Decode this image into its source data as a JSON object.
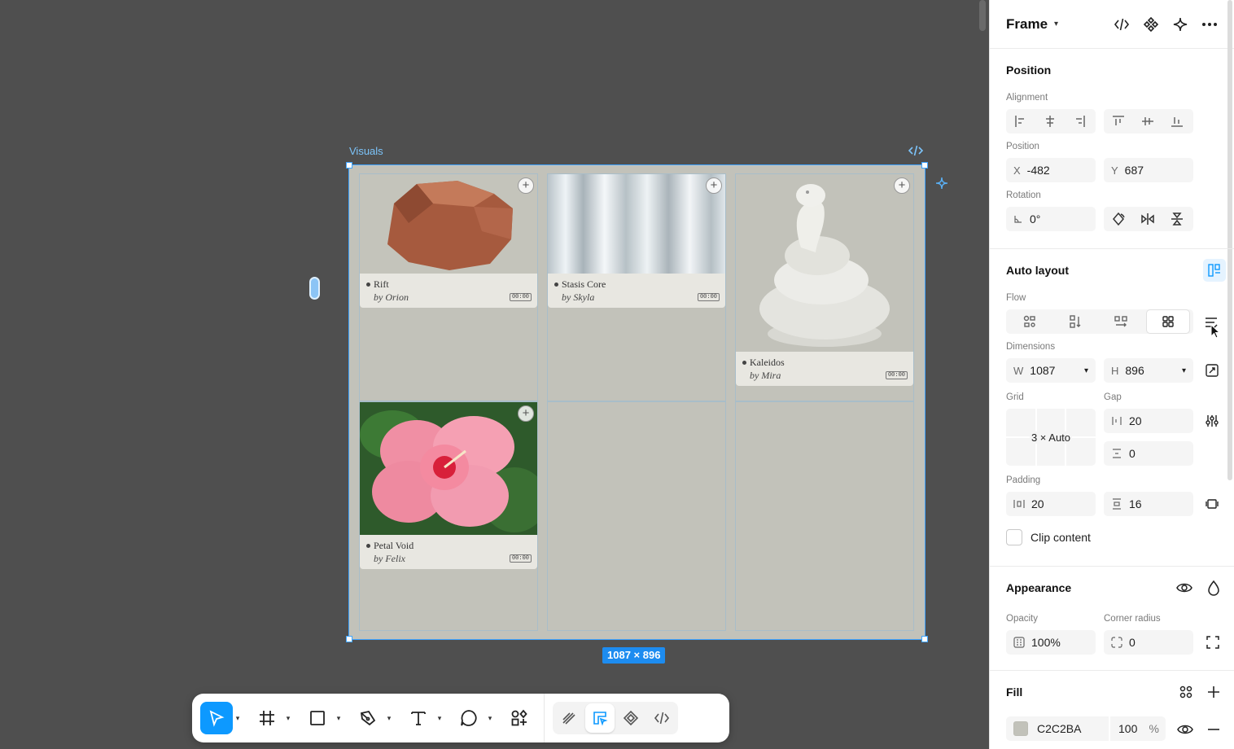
{
  "canvas": {
    "frame_label": "Visuals",
    "size_badge": "1087 × 896",
    "cards": [
      {
        "name": "Rift",
        "by": "by Orion",
        "time": "00:00"
      },
      {
        "name": "Stasis Core",
        "by": "by Skyla",
        "time": "00:00"
      },
      {
        "name": "Kaleidos",
        "by": "by Mira",
        "time": "00:00"
      },
      {
        "name": "Petal Void",
        "by": "by Felix",
        "time": "00:00"
      }
    ],
    "colors": {
      "selection": "#3ea3ff",
      "frame_fill": "#c2c2ba"
    }
  },
  "toolbar": {
    "tools": [
      "move-tool",
      "frame-tool",
      "rectangle-tool",
      "pen-tool",
      "text-tool",
      "comment-tool",
      "assets-tool"
    ],
    "modes": [
      "draw-mode",
      "design-mode",
      "dev-component-mode",
      "dev-mode"
    ]
  },
  "panel": {
    "title": "Frame",
    "position": {
      "section_title": "Position",
      "alignment_label": "Alignment",
      "position_label": "Position",
      "x_prefix": "X",
      "x_value": "-482",
      "y_prefix": "Y",
      "y_value": "687",
      "rotation_label": "Rotation",
      "rotation_value": "0°"
    },
    "auto_layout": {
      "section_title": "Auto layout",
      "flow_label": "Flow",
      "dimensions_label": "Dimensions",
      "w_prefix": "W",
      "w_value": "1087",
      "h_prefix": "H",
      "h_value": "896",
      "grid_label": "Grid",
      "grid_value": "3 × Auto",
      "gap_label": "Gap",
      "gap_h": "20",
      "gap_v": "0",
      "padding_label": "Padding",
      "padding_h": "20",
      "padding_v": "16",
      "clip_label": "Clip content"
    },
    "appearance": {
      "section_title": "Appearance",
      "opacity_label": "Opacity",
      "opacity_value": "100%",
      "radius_label": "Corner radius",
      "radius_value": "0"
    },
    "fill": {
      "section_title": "Fill",
      "hex": "C2C2BA",
      "opacity": "100",
      "percent": "%",
      "swatch": "#c2c2ba"
    }
  }
}
